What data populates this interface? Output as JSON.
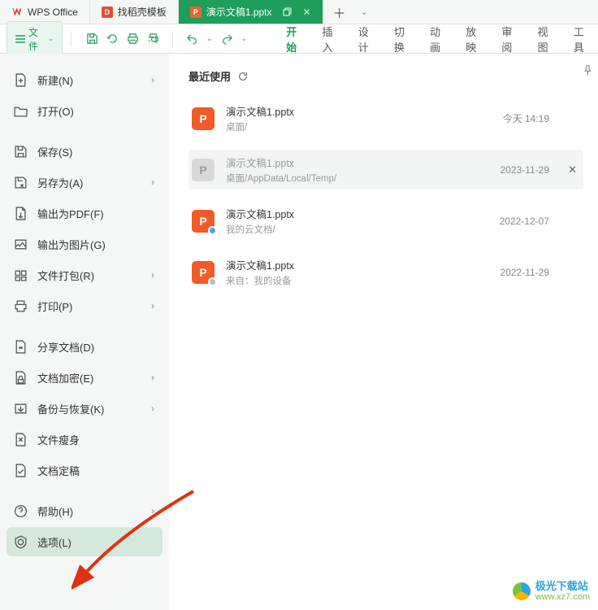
{
  "tabs": {
    "wps": "WPS Office",
    "docker": "找稻壳模板",
    "active": "演示文稿1.pptx"
  },
  "file_button": "文件",
  "ribbon_tabs": [
    "开始",
    "插入",
    "设计",
    "切换",
    "动画",
    "放映",
    "审阅",
    "视图",
    "工具"
  ],
  "sidebar": {
    "items": [
      {
        "label": "新建(N)",
        "chev": true
      },
      {
        "label": "打开(O)",
        "chev": false
      },
      {
        "label": "保存(S)",
        "chev": false
      },
      {
        "label": "另存为(A)",
        "chev": true
      },
      {
        "label": "输出为PDF(F)",
        "chev": false
      },
      {
        "label": "输出为图片(G)",
        "chev": false
      },
      {
        "label": "文件打包(R)",
        "chev": true
      },
      {
        "label": "打印(P)",
        "chev": true
      },
      {
        "label": "分享文档(D)",
        "chev": false
      },
      {
        "label": "文档加密(E)",
        "chev": true
      },
      {
        "label": "备份与恢复(K)",
        "chev": true
      },
      {
        "label": "文件瘦身",
        "chev": false
      },
      {
        "label": "文档定稿",
        "chev": false
      },
      {
        "label": "帮助(H)",
        "chev": true
      },
      {
        "label": "选项(L)",
        "chev": false
      }
    ]
  },
  "recent": {
    "title": "最近使用",
    "items": [
      {
        "name": "演示文稿1.pptx",
        "path": "桌面/",
        "date": "今天  14:19",
        "gray": false,
        "close": false
      },
      {
        "name": "演示文稿1.pptx",
        "path": "桌面/AppData/Local/Temp/",
        "date": "2023-11-29",
        "gray": true,
        "close": true
      },
      {
        "name": "演示文稿1.pptx",
        "path": "我的云文档/",
        "date": "2022-12-07",
        "gray": false,
        "close": false
      },
      {
        "name": "演示文稿1.pptx",
        "path": "来自：我的设备",
        "date": "2022-11-29",
        "gray": false,
        "close": false
      }
    ]
  },
  "watermark": {
    "line1": "极光下载站",
    "line2": "www.xz7.com"
  }
}
